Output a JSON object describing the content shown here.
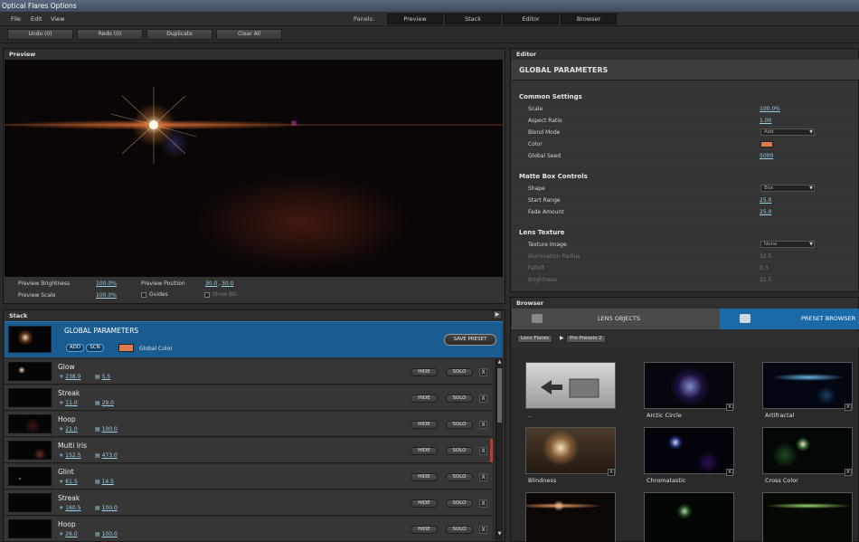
{
  "app": {
    "title": "Optical Flares Options"
  },
  "menu": {
    "file": "File",
    "edit": "Edit",
    "view": "View",
    "panels_label": "Panels:"
  },
  "panel_tabs": [
    "Preview",
    "Stack",
    "Editor",
    "Browser"
  ],
  "toolbar": {
    "undo": "Undo (0)",
    "redo": "Redo (0)",
    "duplicate": "Duplicate",
    "clear_all": "Clear All"
  },
  "preview": {
    "title": "Preview",
    "brightness_label": "Preview Brightness",
    "brightness_value": "100.0%",
    "scale_label": "Preview Scale",
    "scale_value": "100.0%",
    "position_label": "Preview Position",
    "position_x": "30.0",
    "position_sep": ",",
    "position_y": "30.0",
    "guides_label": "Guides",
    "show_bg_label": "Show BG"
  },
  "editor": {
    "title": "Editor",
    "header": "GLOBAL PARAMETERS",
    "common": {
      "title": "Common Settings",
      "scale_label": "Scale",
      "scale_value": "100.0%",
      "aspect_label": "Aspect Ratio",
      "aspect_value": "1.00",
      "blend_label": "Blend Mode",
      "blend_value": "Add",
      "color_label": "Color",
      "color_hex": "#e07a50",
      "seed_label": "Global Seed",
      "seed_value": "5000"
    },
    "matte": {
      "title": "Matte Box Controls",
      "shape_label": "Shape",
      "shape_value": "Box",
      "start_label": "Start Range",
      "start_value": "25.0",
      "fade_label": "Fade Amount",
      "fade_value": "25.0"
    },
    "texture": {
      "title": "Lens Texture",
      "image_label": "Texture Image",
      "image_value": "None",
      "illum_label": "Illumination Radius",
      "illum_value": "32.5",
      "falloff_label": "Falloff",
      "falloff_value": "0.3",
      "bright_label": "Brightness",
      "bright_value": "22.5"
    }
  },
  "stack": {
    "title": "Stack",
    "global": {
      "title": "GLOBAL PARAMETERS",
      "add": "ADD",
      "scn": "SCN",
      "color_label": "Global Color",
      "save_preset": "SAVE PRESET"
    },
    "hide_label": "HIDE",
    "solo_label": "SOLO",
    "x_label": "X",
    "layers": [
      {
        "name": "Glow",
        "v1": "238.0",
        "v2": "5.5"
      },
      {
        "name": "Streak",
        "v1": "11.0",
        "v2": "29.0"
      },
      {
        "name": "Hoop",
        "v1": "21.0",
        "v2": "100.0"
      },
      {
        "name": "Multi Iris",
        "v1": "152.5",
        "v2": "473.0"
      },
      {
        "name": "Glint",
        "v1": "61.5",
        "v2": "14.5"
      },
      {
        "name": "Streak",
        "v1": "160.5",
        "v2": "100.0"
      },
      {
        "name": "Hoop",
        "v1": "26.0",
        "v2": "100.0"
      }
    ]
  },
  "browser": {
    "title": "Browser",
    "lens_tab": "LENS OBJECTS",
    "preset_tab": "PRESET BROWSER",
    "crumb1": "Lens Flares",
    "crumb2": "Pro Presets 2",
    "x_label": "X",
    "items": [
      {
        "label": ".."
      },
      {
        "label": "Arctic Circle"
      },
      {
        "label": "Artifractal"
      },
      {
        "label": "Blindness"
      },
      {
        "label": "Chromatastic"
      },
      {
        "label": "Cross Color"
      }
    ]
  }
}
